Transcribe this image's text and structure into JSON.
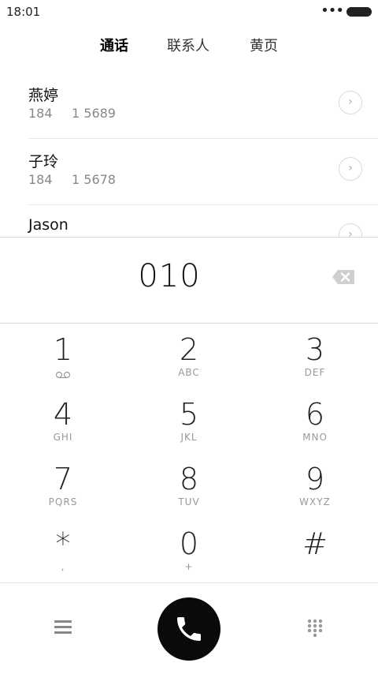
{
  "status_bar": {
    "time": "18:01",
    "dots": "•••"
  },
  "tabs": [
    {
      "label": "通话",
      "active": true
    },
    {
      "label": "联系人",
      "active": false
    },
    {
      "label": "黄页",
      "active": false
    }
  ],
  "contacts": [
    {
      "name": "燕婷",
      "number_part1": "184",
      "number_part2": "1 5689"
    },
    {
      "name": "子玲",
      "number_part1": "184",
      "number_part2": "1 5678"
    },
    {
      "name": "Jason",
      "number_part1": "",
      "number_part2": ""
    }
  ],
  "display": {
    "number": "010"
  },
  "keypad": [
    {
      "digit": "1",
      "letters": ""
    },
    {
      "digit": "2",
      "letters": "ABC"
    },
    {
      "digit": "3",
      "letters": "DEF"
    },
    {
      "digit": "4",
      "letters": "GHI"
    },
    {
      "digit": "5",
      "letters": "JKL"
    },
    {
      "digit": "6",
      "letters": "MNO"
    },
    {
      "digit": "7",
      "letters": "PQRS"
    },
    {
      "digit": "8",
      "letters": "TUV"
    },
    {
      "digit": "9",
      "letters": "WXYZ"
    },
    {
      "digit": "*",
      "letters": ","
    },
    {
      "digit": "0",
      "letters": "+"
    },
    {
      "digit": "#",
      "letters": ""
    }
  ],
  "icons": {
    "voicemail": "voicemail-icon",
    "backspace": "backspace-icon",
    "menu": "menu-icon",
    "call": "phone-icon",
    "keypad_toggle": "dialpad-icon",
    "chevron": "chevron-right-icon"
  },
  "colors": {
    "call_button": "#0a0a0a",
    "secondary_text": "#888888"
  }
}
